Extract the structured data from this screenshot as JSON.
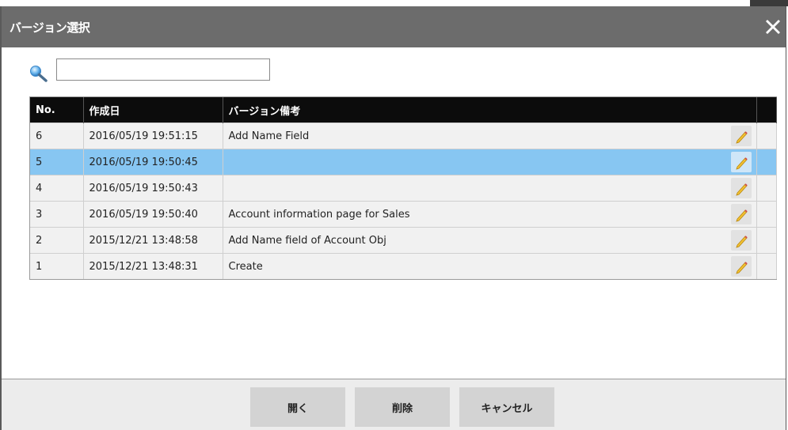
{
  "dialog": {
    "title": "バージョン選択"
  },
  "search": {
    "value": "",
    "placeholder": ""
  },
  "table": {
    "headers": [
      "No.",
      "作成日",
      "バージョン備考",
      ""
    ],
    "rows": [
      {
        "no": "6",
        "date": "2016/05/19 19:51:15",
        "note": "Add Name Field"
      },
      {
        "no": "5",
        "date": "2016/05/19 19:50:45",
        "note": ""
      },
      {
        "no": "4",
        "date": "2016/05/19 19:50:43",
        "note": ""
      },
      {
        "no": "3",
        "date": "2016/05/19 19:50:40",
        "note": "Account information page for Sales"
      },
      {
        "no": "2",
        "date": "2015/12/21 13:48:58",
        "note": "Add Name field of Account Obj"
      },
      {
        "no": "1",
        "date": "2015/12/21 13:48:31",
        "note": "Create"
      }
    ],
    "selected_row": "5"
  },
  "footer": {
    "open_label": "開く",
    "delete_label": "削除",
    "cancel_label": "キャンセル"
  },
  "icons": {
    "close": "close-icon",
    "search": "search-icon",
    "edit": "pencil-icon"
  },
  "colors": {
    "titlebar": "#6c6c6c",
    "header": "#0c0c0c",
    "row": "#f1f1f1",
    "selected_row": "#87c6f2",
    "button": "#d3d3d3"
  }
}
